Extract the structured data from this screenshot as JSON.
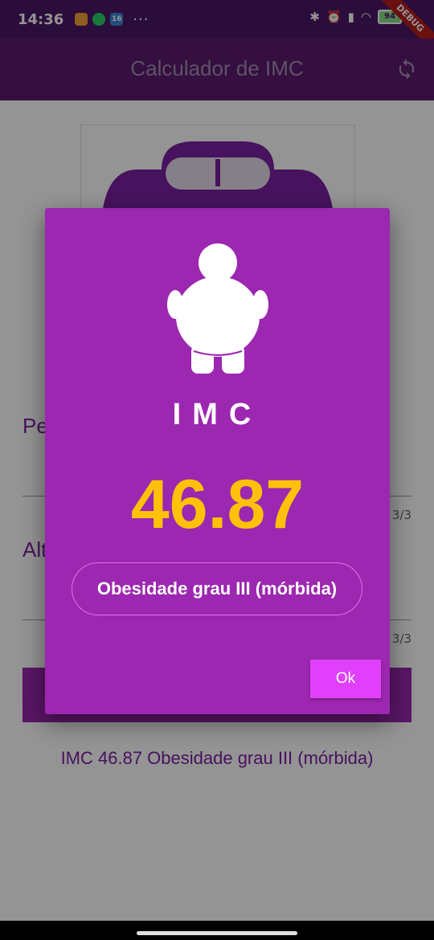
{
  "status_bar": {
    "time": "14:36",
    "notification_badge": "16",
    "dots": "···",
    "battery": "94"
  },
  "debug_banner": "DEBUG",
  "app_bar": {
    "title": "Calculador de IMC",
    "action_icon": "refresh-icon"
  },
  "form": {
    "weight_label": "Peso (kg)",
    "height_label": "Altura (cm)",
    "weight_counter": "3/3",
    "height_counter": "3/3"
  },
  "result_text": "IMC 46.87 Obesidade grau III (mórbida)",
  "dialog": {
    "title": "IMC",
    "value": "46.87",
    "category": "Obesidade grau III (mórbida)",
    "ok_label": "Ok",
    "icon": "obese-person-icon"
  },
  "colors": {
    "status_bar": "#4a1766",
    "app_bar": "#5b1b6e",
    "dialog_bg": "#9c27b0",
    "value": "#ffc107",
    "ok_button": "#e040fb"
  }
}
